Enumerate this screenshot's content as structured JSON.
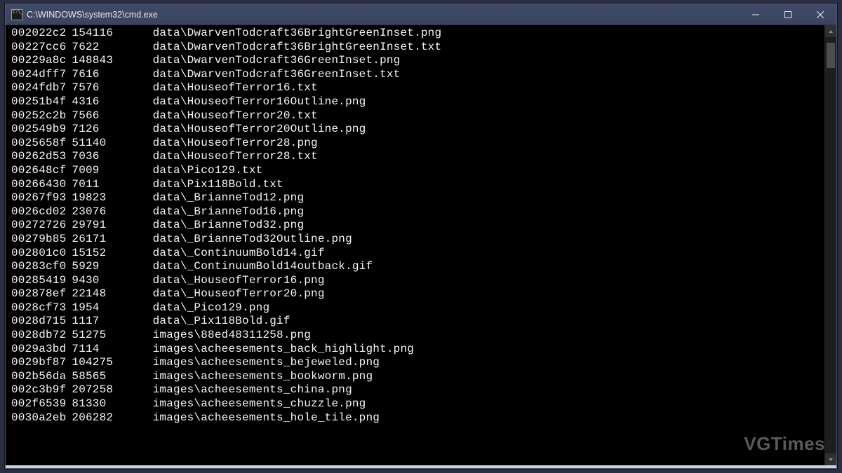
{
  "window": {
    "title": "C:\\WINDOWS\\system32\\cmd.exe"
  },
  "watermark": "VGTimes",
  "rows": [
    {
      "addr": "002022c2",
      "size": "154116",
      "path": "data\\DwarvenTodcraft36BrightGreenInset.png"
    },
    {
      "addr": "00227cc6",
      "size": "7622",
      "path": "data\\DwarvenTodcraft36BrightGreenInset.txt"
    },
    {
      "addr": "00229a8c",
      "size": "148843",
      "path": "data\\DwarvenTodcraft36GreenInset.png"
    },
    {
      "addr": "0024dff7",
      "size": "7616",
      "path": "data\\DwarvenTodcraft36GreenInset.txt"
    },
    {
      "addr": "0024fdb7",
      "size": "7576",
      "path": "data\\HouseofTerror16.txt"
    },
    {
      "addr": "00251b4f",
      "size": "4316",
      "path": "data\\HouseofTerror16Outline.png"
    },
    {
      "addr": "00252c2b",
      "size": "7566",
      "path": "data\\HouseofTerror20.txt"
    },
    {
      "addr": "002549b9",
      "size": "7126",
      "path": "data\\HouseofTerror20Outline.png"
    },
    {
      "addr": "0025658f",
      "size": "51140",
      "path": "data\\HouseofTerror28.png"
    },
    {
      "addr": "00262d53",
      "size": "7036",
      "path": "data\\HouseofTerror28.txt"
    },
    {
      "addr": "002648cf",
      "size": "7009",
      "path": "data\\Pico129.txt"
    },
    {
      "addr": "00266430",
      "size": "7011",
      "path": "data\\Pix118Bold.txt"
    },
    {
      "addr": "00267f93",
      "size": "19823",
      "path": "data\\_BrianneTod12.png"
    },
    {
      "addr": "0026cd02",
      "size": "23076",
      "path": "data\\_BrianneTod16.png"
    },
    {
      "addr": "00272726",
      "size": "29791",
      "path": "data\\_BrianneTod32.png"
    },
    {
      "addr": "00279b85",
      "size": "26171",
      "path": "data\\_BrianneTod32Outline.png"
    },
    {
      "addr": "002801c0",
      "size": "15152",
      "path": "data\\_ContinuumBold14.gif"
    },
    {
      "addr": "00283cf0",
      "size": "5929",
      "path": "data\\_ContinuumBold14outback.gif"
    },
    {
      "addr": "00285419",
      "size": "9430",
      "path": "data\\_HouseofTerror16.png"
    },
    {
      "addr": "002878ef",
      "size": "22148",
      "path": "data\\_HouseofTerror20.png"
    },
    {
      "addr": "0028cf73",
      "size": "1954",
      "path": "data\\_Pico129.png"
    },
    {
      "addr": "0028d715",
      "size": "1117",
      "path": "data\\_Pix118Bold.gif"
    },
    {
      "addr": "0028db72",
      "size": "51275",
      "path": "images\\88ed48311258.png"
    },
    {
      "addr": "0029a3bd",
      "size": "7114",
      "path": "images\\acheesements_back_highlight.png"
    },
    {
      "addr": "0029bf87",
      "size": "104275",
      "path": "images\\acheesements_bejeweled.png"
    },
    {
      "addr": "002b56da",
      "size": "58565",
      "path": "images\\acheesements_bookworm.png"
    },
    {
      "addr": "002c3b9f",
      "size": "207258",
      "path": "images\\acheesements_china.png"
    },
    {
      "addr": "002f6539",
      "size": "81330",
      "path": "images\\acheesements_chuzzle.png"
    },
    {
      "addr": "0030a2eb",
      "size": "206282",
      "path": "images\\acheesements_hole_tile.png"
    }
  ]
}
